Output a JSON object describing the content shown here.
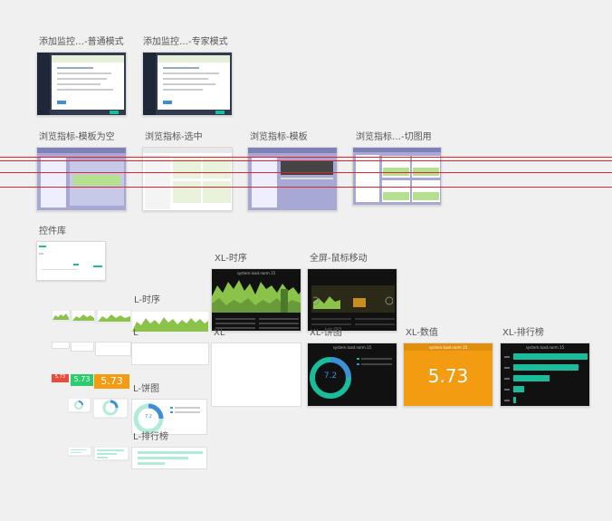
{
  "thumbnails": {
    "add_normal": "添加监控…-普通模式",
    "add_expert": "添加监控…-专家模式",
    "browse_empty": "浏览指标-模板为空",
    "browse_selected": "浏览指标-选中",
    "browse_template": "浏览指标-模板",
    "browse_switch": "浏览指标…-切图用",
    "widget_lib": "控件库",
    "xl_timeseries": "XL-时序",
    "fullscreen_hover": "全屏-鼠标移动",
    "l_timeseries": "L-时序",
    "l_plain": "L",
    "xl_plain": "XL",
    "xl_pie": "XL-饼图",
    "xl_value": "XL-数值",
    "xl_rank": "XL-排行榜",
    "l_pie": "L-饼图",
    "l_rank": "L-排行榜"
  },
  "widgets": {
    "chart_title": "system.load.norm.15",
    "value": "5.73",
    "pie_value": "7.2"
  },
  "colors": {
    "accent_green": "#1abc9c",
    "accent_orange": "#f39c12",
    "accent_red": "#e74c3c",
    "accent_blue": "#3d8fd8",
    "chart_green": "#8bc34a"
  }
}
